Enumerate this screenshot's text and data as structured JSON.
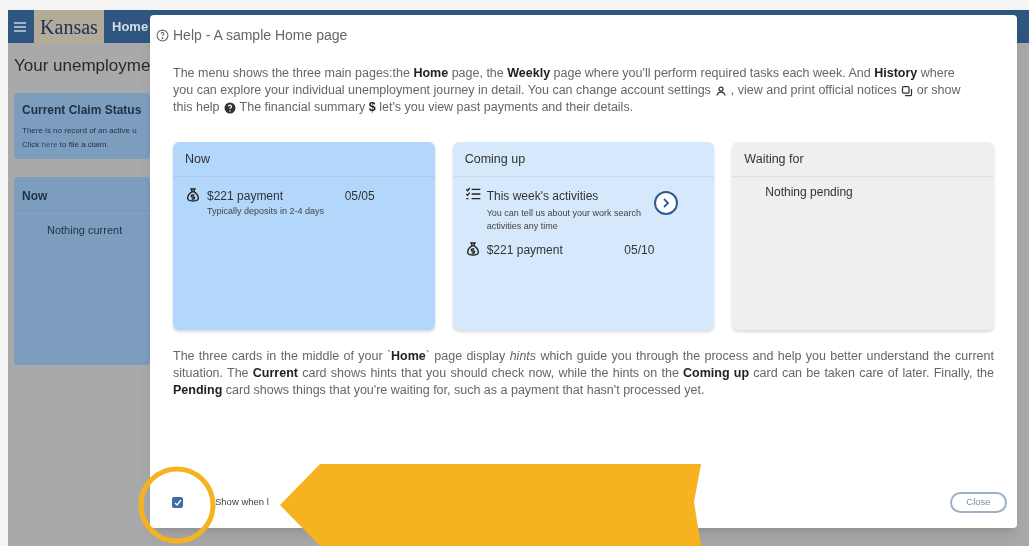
{
  "header": {
    "brand": "Kansas",
    "nav_item": "Home"
  },
  "page": {
    "title": "Your unemployme",
    "status_card": {
      "title": "Current Claim Status",
      "line_1": "There is no record of an active u",
      "line_2_before": "Click ",
      "link": "here",
      "line_2_after": " to file a claim."
    },
    "now_card": {
      "title": "Now",
      "empty_text": "Nothing current"
    }
  },
  "dialog": {
    "title": "Help - A sample Home page",
    "intro_lines": [
      [
        "The menu shows the three main pages:the **Home** page, the **Weekly** page where you'll perform required tasks each week. And **History** where"
      ],
      [
        "you can explore your individual unemployment journey in detail. You can change account settings",
        ", view and print official notices",
        "or show"
      ],
      [
        "this help",
        "The financial summary **$** let's you view past payments and their details."
      ]
    ],
    "cards": [
      {
        "title": "Now",
        "color": "#b3d7fb",
        "items": [
          {
            "kind": "payment",
            "title": "$221 payment",
            "date": "05/05",
            "note": "Typically deposits in 2-4 days"
          }
        ]
      },
      {
        "title": "Coming up",
        "color": "#d6e8fc",
        "items": [
          {
            "kind": "activity",
            "title": "This week's activities",
            "note": "You can tell us about your work search activities any time"
          },
          {
            "kind": "payment",
            "title": "$221 payment",
            "date": "05/10"
          }
        ]
      },
      {
        "title": "Waiting for",
        "color": "#efefef",
        "empty_text": "Nothing pending"
      }
    ],
    "outro": "The three cards in the middle of your `**Home**` page display *hints* which guide you through the process and help you better understand the current situation. The **Current** card shows hints that you should check now, while the hints on the **Coming up** card can be taken care of later. Finally, the **Pending** card shows things that you're waiting for, such as a payment that hasn't processed yet.",
    "show_on_start": {
      "label": "Show when l",
      "checked": true
    },
    "close_label": "Close"
  }
}
